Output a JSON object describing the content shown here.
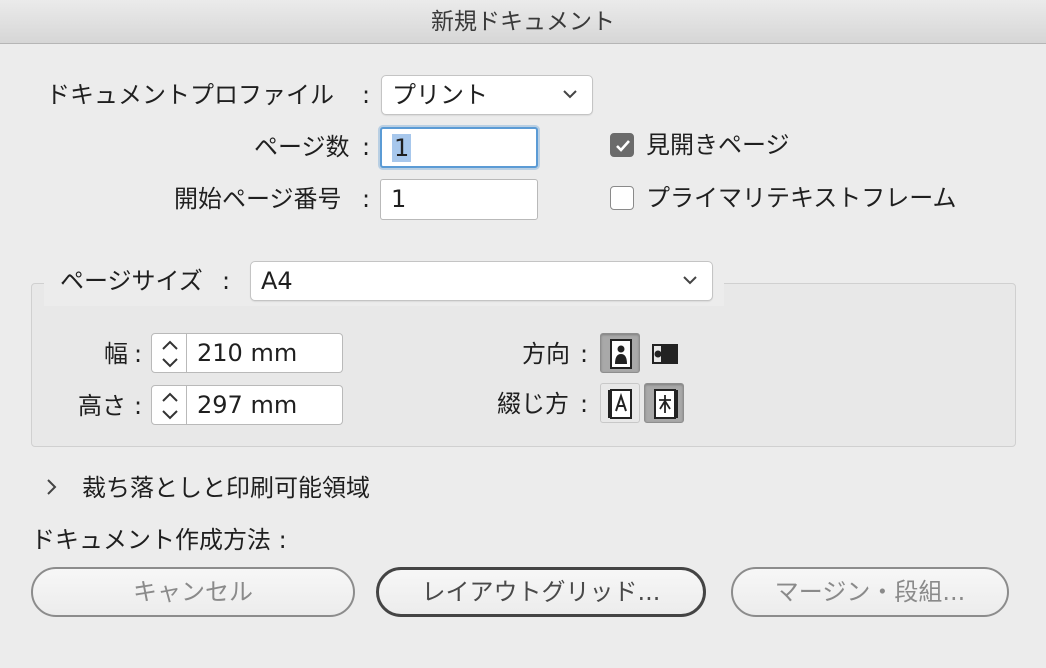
{
  "window": {
    "title": "新規ドキュメント"
  },
  "document": {
    "profile_label": "ドキュメントプロファイル",
    "profile_value": "プリント",
    "pages_label": "ページ数",
    "pages_value": "1",
    "start_page_label": "開始ページ番号",
    "start_page_value": "1",
    "facing_pages_label": "見開きページ",
    "facing_pages_checked": true,
    "primary_text_frame_label": "プライマリテキストフレーム",
    "primary_text_frame_checked": false,
    "colon": ":"
  },
  "page_size": {
    "label": "ページサイズ",
    "value": "A4",
    "width_label": "幅",
    "width_value": "210 mm",
    "height_label": "高さ",
    "height_value": "297 mm",
    "orientation_label": "方向",
    "orientation_selected": "portrait",
    "binding_label": "綴じ方",
    "binding_selected": "right-to-left"
  },
  "bleed": {
    "label": "裁ち落としと印刷可能領域"
  },
  "creation": {
    "label": "ドキュメント作成方法 :"
  },
  "buttons": {
    "cancel": "キャンセル",
    "layout_grid": "レイアウトグリッド...",
    "margins": "マージン・段組..."
  }
}
